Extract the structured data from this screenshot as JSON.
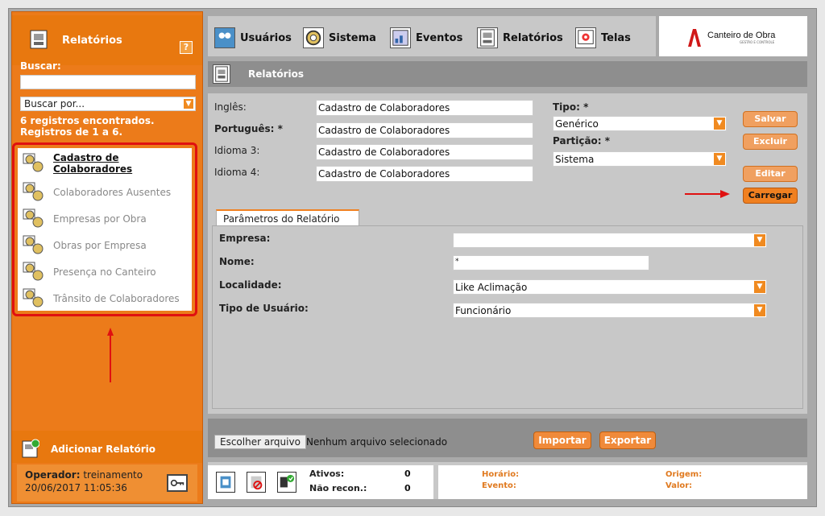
{
  "sidebar": {
    "title": "Relatórios",
    "help": "?",
    "search_label": "Buscar:",
    "search_value": "",
    "search_by": "Buscar por...",
    "info_line1": "6 registros encontrados.",
    "info_line2": "Registros de 1 a 6.",
    "items": [
      {
        "label": "Cadastro de Colaboradores"
      },
      {
        "label": "Colaboradores Ausentes"
      },
      {
        "label": "Empresas por Obra"
      },
      {
        "label": "Obras por Empresa"
      },
      {
        "label": "Presença no Canteiro"
      },
      {
        "label": "Trânsito de Colaboradores"
      }
    ],
    "add_label": "Adicionar Relatório",
    "operator_label": "Operador:",
    "operator_name": "treinamento",
    "datetime": "20/06/2017  11:05:36"
  },
  "nav": {
    "items": [
      {
        "label": "Usuários"
      },
      {
        "label": "Sistema"
      },
      {
        "label": "Eventos"
      },
      {
        "label": "Relatórios"
      },
      {
        "label": "Telas"
      }
    ]
  },
  "logo": {
    "text": "Canteiro de Obra",
    "sub": "GESTÃO E CONTROLE"
  },
  "page_title": "Relatórios",
  "form": {
    "ingles_label": "Inglês:",
    "ingles_value": "Cadastro de Colaboradores",
    "portugues_label": "Português: *",
    "portugues_value": "Cadastro de Colaboradores",
    "idioma3_label": "Idioma 3:",
    "idioma3_value": "Cadastro de Colaboradores",
    "idioma4_label": "Idioma 4:",
    "idioma4_value": "Cadastro de Colaboradores",
    "tipo_label": "Tipo: *",
    "tipo_value": "Genérico",
    "particao_label": "Partição: *",
    "particao_value": "Sistema"
  },
  "buttons": {
    "salvar": "Salvar",
    "excluir": "Excluir",
    "editar": "Editar",
    "carregar": "Carregar"
  },
  "params": {
    "tab": "Parâmetros do Relatório",
    "empresa_label": "Empresa:",
    "empresa_value": "",
    "nome_label": "Nome:",
    "nome_value": "*",
    "localidade_label": "Localidade:",
    "localidade_value": "Like Aclimação",
    "tipo_usuario_label": "Tipo de Usuário:",
    "tipo_usuario_value": "Funcionário"
  },
  "import": {
    "choose_file": "Escolher arquivo",
    "no_file": "Nenhum arquivo selecionado",
    "importar": "Importar",
    "exportar": "Exportar"
  },
  "status": {
    "ativos_label": "Ativos:",
    "ativos_value": "0",
    "nao_recon_label": "Não recon.:",
    "nao_recon_value": "0",
    "horario_label": "Horário:",
    "evento_label": "Evento:",
    "origem_label": "Origem:",
    "valor_label": "Valor:"
  },
  "colors": {
    "accent": "#ec7b1a",
    "highlight_red": "#e01010"
  }
}
